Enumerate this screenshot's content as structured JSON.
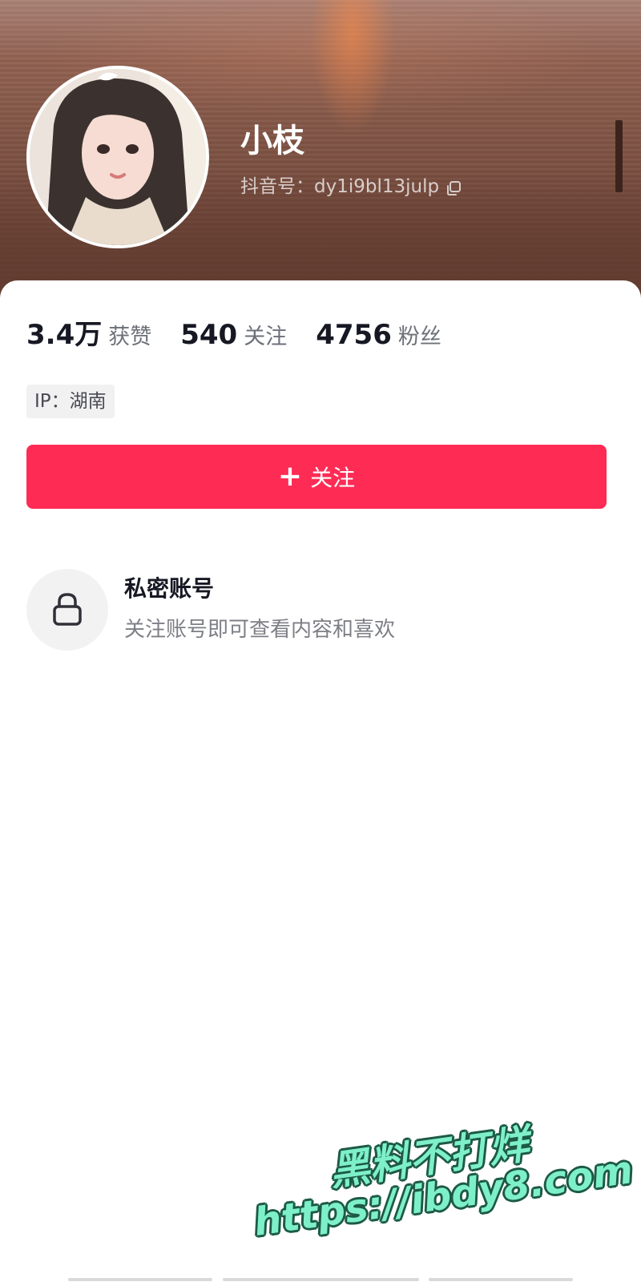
{
  "profile": {
    "name": "小枝",
    "douyin_id": "抖音号：dy1i9bl13julp",
    "ip_location": "IP：湖南"
  },
  "stats": [
    {
      "value": "3.4万",
      "label": "获赞"
    },
    {
      "value": "540",
      "label": "关注"
    },
    {
      "value": "4756",
      "label": "粉丝"
    }
  ],
  "actions": {
    "follow_label": "关注",
    "follow_icon": "plus-icon",
    "copy_icon": "copy-icon"
  },
  "private_notice": {
    "title": "私密账号",
    "description": "关注账号即可查看内容和喜欢",
    "icon": "lock-icon"
  },
  "watermark": {
    "line1": "黑料不打烊",
    "line2": "https://ibdy8.com"
  },
  "colors": {
    "accent": "#fe2c55",
    "primary_text": "#161823",
    "secondary_text": "#6e7079",
    "watermark_fill": "#7ef0c9"
  }
}
